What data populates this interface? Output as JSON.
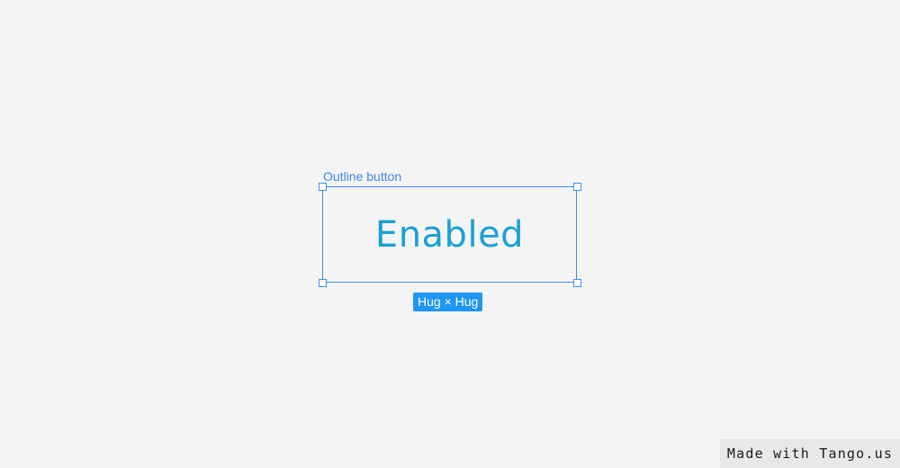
{
  "canvas": {
    "frame_label": "Outline button",
    "button_text": "Enabled",
    "size_badge": "Hug × Hug"
  },
  "watermark": {
    "text": "Made with Tango.us"
  },
  "colors": {
    "selection": "#3d8ff0",
    "button_text": "#1aa0d4",
    "badge_bg": "#1e96f5",
    "background": "#f4f4f4"
  }
}
